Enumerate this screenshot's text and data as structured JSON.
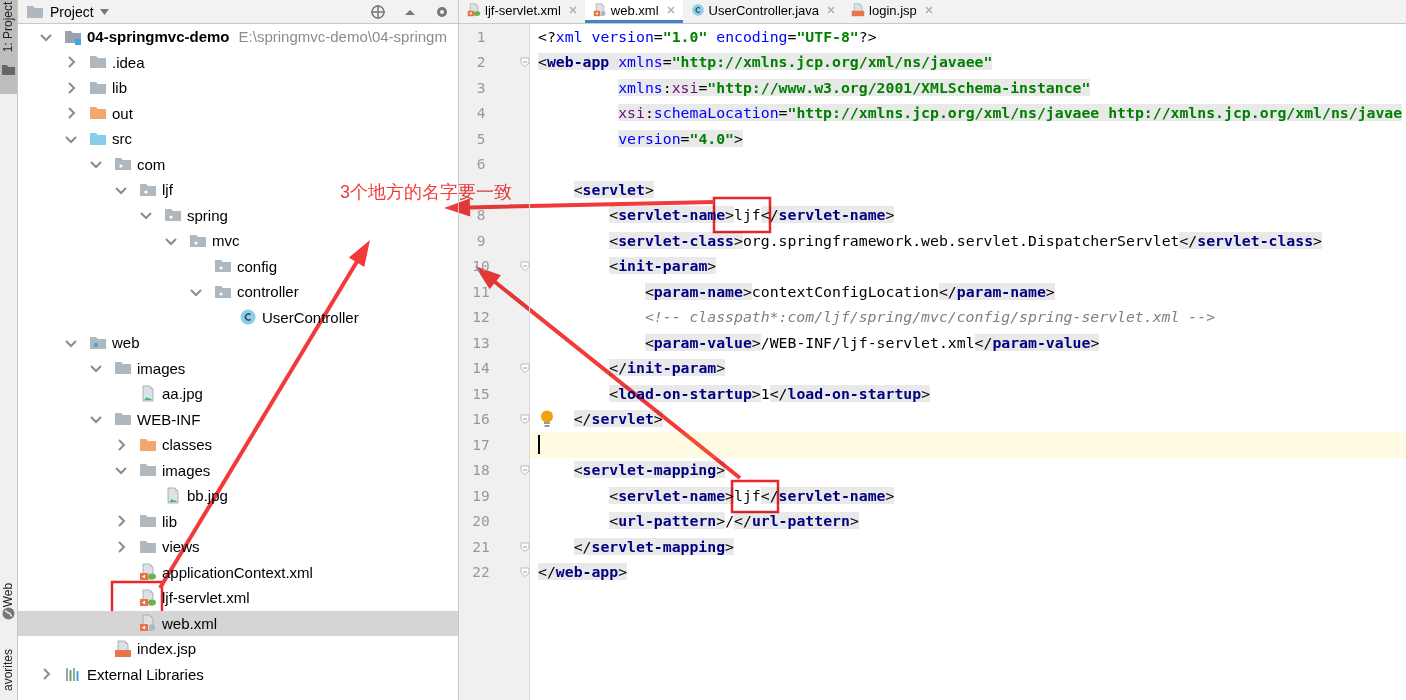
{
  "side_strip": [
    {
      "label": "1: Project",
      "kind": "project",
      "selected": true
    },
    {
      "label": "Web",
      "kind": "web",
      "selected": false
    },
    {
      "label": "avorites",
      "kind": "favorites",
      "selected": false
    }
  ],
  "project_panel": {
    "title": "Project"
  },
  "tree": [
    {
      "label": "04-springmvc-demo",
      "path": "E:\\springmvc-demo\\04-springm",
      "kind": "module",
      "expanded": true,
      "selected": false,
      "children": [
        {
          "label": ".idea",
          "kind": "folder",
          "expanded": false,
          "selected": false
        },
        {
          "label": "lib",
          "kind": "folder",
          "expanded": false,
          "selected": false
        },
        {
          "label": "out",
          "kind": "excluded",
          "expanded": false,
          "selected": false
        },
        {
          "label": "src",
          "kind": "source",
          "expanded": true,
          "selected": false,
          "children": [
            {
              "label": "com",
              "kind": "package",
              "expanded": true,
              "selected": false,
              "children": [
                {
                  "label": "ljf",
                  "kind": "package",
                  "expanded": true,
                  "selected": false,
                  "children": [
                    {
                      "label": "spring",
                      "kind": "package",
                      "expanded": true,
                      "selected": false,
                      "children": [
                        {
                          "label": "mvc",
                          "kind": "package",
                          "expanded": true,
                          "selected": false,
                          "children": [
                            {
                              "label": "config",
                              "kind": "package",
                              "selected": false
                            },
                            {
                              "label": "controller",
                              "kind": "package",
                              "expanded": true,
                              "selected": false,
                              "children": [
                                {
                                  "label": "UserController",
                                  "kind": "class",
                                  "selected": false
                                }
                              ]
                            }
                          ]
                        }
                      ]
                    }
                  ]
                }
              ]
            }
          ]
        },
        {
          "label": "web",
          "kind": "web",
          "expanded": true,
          "selected": false,
          "children": [
            {
              "label": "images",
              "kind": "folder",
              "expanded": true,
              "selected": false,
              "children": [
                {
                  "label": "aa.jpg",
                  "kind": "image",
                  "selected": false
                }
              ]
            },
            {
              "label": "WEB-INF",
              "kind": "folder",
              "expanded": true,
              "selected": false,
              "children": [
                {
                  "label": "classes",
                  "kind": "excluded",
                  "expanded": false,
                  "selected": false
                },
                {
                  "label": "images",
                  "kind": "folder",
                  "expanded": true,
                  "selected": false,
                  "children": [
                    {
                      "label": "bb.jpg",
                      "kind": "image",
                      "selected": false
                    }
                  ]
                },
                {
                  "label": "lib",
                  "kind": "folder",
                  "expanded": false,
                  "selected": false
                },
                {
                  "label": "views",
                  "kind": "folder",
                  "expanded": false,
                  "selected": false
                },
                {
                  "label": "applicationContext.xml",
                  "kind": "spring-xml",
                  "selected": false
                },
                {
                  "label": "ljf-servlet.xml",
                  "kind": "spring-xml",
                  "selected": false
                },
                {
                  "label": "web.xml",
                  "kind": "web-xml",
                  "selected": true
                }
              ]
            },
            {
              "label": "index.jsp",
              "kind": "jsp",
              "selected": false
            }
          ]
        }
      ]
    },
    {
      "label": "External Libraries",
      "kind": "libraries",
      "expanded": false,
      "selected": false
    }
  ],
  "tabs": [
    {
      "label": "ljf-servlet.xml",
      "kind": "spring-xml",
      "selected": false
    },
    {
      "label": "web.xml",
      "kind": "web-xml",
      "selected": true
    },
    {
      "label": "UserController.java",
      "kind": "class",
      "selected": false
    },
    {
      "label": "login.jsp",
      "kind": "jsp",
      "selected": false
    }
  ],
  "editor": {
    "lines": [
      {
        "number": "1",
        "current": false,
        "tag_highlight": false,
        "fold": false,
        "bulb": false,
        "tokens": [
          {
            "kind": "p",
            "text": "<?"
          },
          {
            "kind": "a",
            "text": "xml"
          },
          {
            "kind": "a",
            "text": " version"
          },
          {
            "kind": "p",
            "text": "="
          },
          {
            "kind": "v",
            "text": "\"1.0\""
          },
          {
            "kind": "a",
            "text": " encoding"
          },
          {
            "kind": "p",
            "text": "="
          },
          {
            "kind": "v",
            "text": "\"UTF-8\""
          },
          {
            "kind": "p",
            "text": "?>"
          }
        ]
      },
      {
        "number": "2",
        "current": false,
        "tag_highlight": true,
        "fold": true,
        "bulb": false,
        "tokens": [
          {
            "kind": "p",
            "text": "<"
          },
          {
            "kind": "t",
            "text": "web-app"
          },
          {
            "kind": "a",
            "text": " xmlns"
          },
          {
            "kind": "p",
            "text": "="
          },
          {
            "kind": "v",
            "text": "\"http://xmlns.jcp.org/xml/ns/javaee\""
          }
        ]
      },
      {
        "number": "3",
        "current": false,
        "tag_highlight": true,
        "fold": false,
        "bulb": false,
        "tokens": [
          {
            "kind": "a",
            "text": "         xmlns"
          },
          {
            "kind": "p",
            "text": ":"
          },
          {
            "kind": "n",
            "text": "xsi"
          },
          {
            "kind": "p",
            "text": "="
          },
          {
            "kind": "v",
            "text": "\"http://www.w3.org/2001/XMLSchema-instance\""
          }
        ]
      },
      {
        "number": "4",
        "current": false,
        "tag_highlight": true,
        "fold": false,
        "bulb": false,
        "tokens": [
          {
            "kind": "n",
            "text": "         xsi"
          },
          {
            "kind": "p",
            "text": ":"
          },
          {
            "kind": "a",
            "text": "schemaLocation"
          },
          {
            "kind": "p",
            "text": "="
          },
          {
            "kind": "v",
            "text": "\"http://xmlns.jcp.org/xml/ns/javaee http://xmlns.jcp.org/xml/ns/javae"
          }
        ]
      },
      {
        "number": "5",
        "current": false,
        "tag_highlight": true,
        "fold": false,
        "bulb": false,
        "tokens": [
          {
            "kind": "a",
            "text": "         version"
          },
          {
            "kind": "p",
            "text": "="
          },
          {
            "kind": "v",
            "text": "\"4.0\""
          },
          {
            "kind": "p",
            "text": ">"
          }
        ]
      },
      {
        "number": "6",
        "current": false,
        "fold": false,
        "bulb": false
      },
      {
        "current": false,
        "tag_highlight": true,
        "fold": false,
        "bulb": false,
        "tokens": [
          {
            "kind": "p",
            "text": "    <"
          },
          {
            "kind": "t",
            "text": "servlet"
          },
          {
            "kind": "p",
            "text": ">"
          }
        ]
      },
      {
        "number": "8",
        "current": false,
        "tag_highlight": true,
        "fold": false,
        "bulb": false,
        "tokens": [
          {
            "kind": "p",
            "text": "        <"
          },
          {
            "kind": "t",
            "text": "servlet-name"
          },
          {
            "kind": "p",
            "text": ">"
          },
          {
            "kind": "x",
            "text": "ljf"
          },
          {
            "kind": "p",
            "text": "</"
          },
          {
            "kind": "t",
            "text": "servlet-name"
          },
          {
            "kind": "p",
            "text": ">"
          }
        ]
      },
      {
        "number": "9",
        "current": false,
        "tag_highlight": true,
        "fold": false,
        "bulb": false,
        "tokens": [
          {
            "kind": "p",
            "text": "        <"
          },
          {
            "kind": "t",
            "text": "servlet-class"
          },
          {
            "kind": "p",
            "text": ">"
          },
          {
            "kind": "x",
            "text": "org.springframework.web.servlet.DispatcherServlet"
          },
          {
            "kind": "p",
            "text": "</"
          },
          {
            "kind": "t",
            "text": "servlet-class"
          },
          {
            "kind": "p",
            "text": ">"
          }
        ]
      },
      {
        "number": "10",
        "current": false,
        "tag_highlight": true,
        "fold": true,
        "bulb": false,
        "tokens": [
          {
            "kind": "p",
            "text": "        <"
          },
          {
            "kind": "t",
            "text": "init-param"
          },
          {
            "kind": "p",
            "text": ">"
          }
        ]
      },
      {
        "number": "11",
        "current": false,
        "tag_highlight": true,
        "fold": false,
        "bulb": false,
        "tokens": [
          {
            "kind": "p",
            "text": "            <"
          },
          {
            "kind": "t",
            "text": "param-name"
          },
          {
            "kind": "p",
            "text": ">"
          },
          {
            "kind": "x",
            "text": "contextConfigLocation"
          },
          {
            "kind": "p",
            "text": "</"
          },
          {
            "kind": "t",
            "text": "param-name"
          },
          {
            "kind": "p",
            "text": ">"
          }
        ]
      },
      {
        "number": "12",
        "current": false,
        "tag_highlight": false,
        "fold": false,
        "bulb": false,
        "tokens": [
          {
            "kind": "c",
            "text": "            <!-- classpath*:com/ljf/spring/mvc/config/spring-servlet.xml -->"
          }
        ]
      },
      {
        "number": "13",
        "current": false,
        "tag_highlight": true,
        "fold": false,
        "bulb": false,
        "tokens": [
          {
            "kind": "p",
            "text": "            <"
          },
          {
            "kind": "t",
            "text": "param-value"
          },
          {
            "kind": "p",
            "text": ">"
          },
          {
            "kind": "x",
            "text": "/WEB-INF/ljf-servlet.xml"
          },
          {
            "kind": "p",
            "text": "</"
          },
          {
            "kind": "t",
            "text": "param-value"
          },
          {
            "kind": "p",
            "text": ">"
          }
        ]
      },
      {
        "number": "14",
        "current": false,
        "tag_highlight": true,
        "fold": true,
        "bulb": false,
        "tokens": [
          {
            "kind": "p",
            "text": "        </"
          },
          {
            "kind": "t",
            "text": "init-param"
          },
          {
            "kind": "p",
            "text": ">"
          }
        ]
      },
      {
        "number": "15",
        "current": false,
        "tag_highlight": true,
        "fold": false,
        "bulb": false,
        "tokens": [
          {
            "kind": "p",
            "text": "        <"
          },
          {
            "kind": "t",
            "text": "load-on-startup"
          },
          {
            "kind": "p",
            "text": ">"
          },
          {
            "kind": "x",
            "text": "1"
          },
          {
            "kind": "p",
            "text": "</"
          },
          {
            "kind": "t",
            "text": "load-on-startup"
          },
          {
            "kind": "p",
            "text": ">"
          }
        ]
      },
      {
        "number": "16",
        "current": false,
        "tag_highlight": true,
        "fold": true,
        "bulb": true,
        "tokens": [
          {
            "kind": "p",
            "text": "    </"
          },
          {
            "kind": "t",
            "text": "servlet"
          },
          {
            "kind": "p",
            "text": ">"
          }
        ]
      },
      {
        "number": "17",
        "current": true,
        "fold": false,
        "bulb": false
      },
      {
        "number": "18",
        "current": false,
        "tag_highlight": true,
        "fold": true,
        "bulb": false,
        "tokens": [
          {
            "kind": "p",
            "text": "    <"
          },
          {
            "kind": "t",
            "text": "servlet-mapping"
          },
          {
            "kind": "p",
            "text": ">"
          }
        ]
      },
      {
        "number": "19",
        "current": false,
        "tag_highlight": true,
        "fold": false,
        "bulb": false,
        "tokens": [
          {
            "kind": "p",
            "text": "        <"
          },
          {
            "kind": "t",
            "text": "servlet-name"
          },
          {
            "kind": "p",
            "text": ">"
          },
          {
            "kind": "x",
            "text": "ljf"
          },
          {
            "kind": "p",
            "text": "</"
          },
          {
            "kind": "t",
            "text": "servlet-name"
          },
          {
            "kind": "p",
            "text": ">"
          }
        ]
      },
      {
        "number": "20",
        "current": false,
        "tag_highlight": true,
        "fold": false,
        "bulb": false,
        "tokens": [
          {
            "kind": "p",
            "text": "        <"
          },
          {
            "kind": "t",
            "text": "url-pattern"
          },
          {
            "kind": "p",
            "text": ">"
          },
          {
            "kind": "x",
            "text": "/"
          },
          {
            "kind": "p",
            "text": "</"
          },
          {
            "kind": "t",
            "text": "url-pattern"
          },
          {
            "kind": "p",
            "text": ">"
          }
        ]
      },
      {
        "number": "21",
        "current": false,
        "tag_highlight": true,
        "fold": true,
        "bulb": false,
        "tokens": [
          {
            "kind": "p",
            "text": "    </"
          },
          {
            "kind": "t",
            "text": "servlet-mapping"
          },
          {
            "kind": "p",
            "text": ">"
          }
        ]
      },
      {
        "number": "22",
        "current": false,
        "tag_highlight": true,
        "fold": true,
        "bulb": false,
        "tokens": [
          {
            "kind": "p",
            "text": "</"
          },
          {
            "kind": "t",
            "text": "web-app"
          },
          {
            "kind": "p",
            "text": ">"
          }
        ]
      }
    ]
  },
  "annotation": {
    "note": "3个地方的名字要一致"
  }
}
